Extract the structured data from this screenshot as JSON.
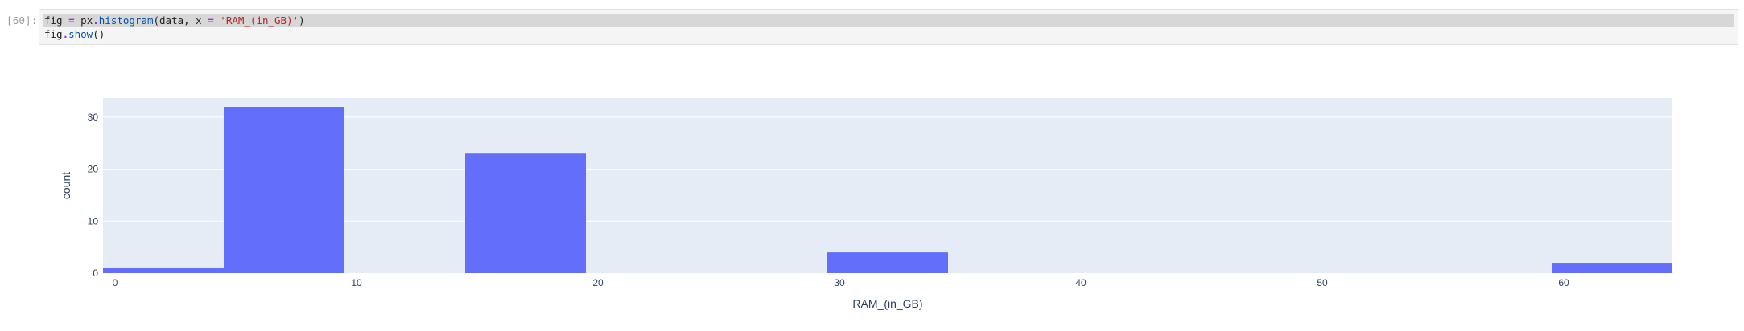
{
  "notebook": {
    "prompt": "[60]:",
    "code": {
      "line1": {
        "fig": "fig",
        "eq": "=",
        "px": "px",
        "dot": ".",
        "fn": "histogram",
        "args_open": "(data, x ",
        "eq2": "=",
        "str": "'RAM_(in_GB)'",
        "close": ")"
      },
      "line2": {
        "fig": "fig",
        "dot": ".",
        "fn": "show",
        "paren": "()"
      }
    }
  },
  "chart_data": {
    "type": "bar",
    "subtype": "histogram",
    "bar_color": "#636efa",
    "plot_bg": "#e5ecf6",
    "bins": [
      {
        "start": -0.5,
        "end": 4.5,
        "count": 1
      },
      {
        "start": 4.5,
        "end": 9.5,
        "count": 32
      },
      {
        "start": 14.5,
        "end": 19.5,
        "count": 23
      },
      {
        "start": 29.5,
        "end": 34.5,
        "count": 4
      },
      {
        "start": 59.5,
        "end": 64.5,
        "count": 2
      }
    ],
    "xlabel": "RAM_(in_GB)",
    "ylabel": "count",
    "xlim": [
      -0.5,
      64.5
    ],
    "ylim": [
      0,
      33.7
    ],
    "x_ticks": [
      "0",
      "10",
      "20",
      "30",
      "40",
      "50",
      "60"
    ],
    "x_tick_values": [
      0,
      10,
      20,
      30,
      40,
      50,
      60
    ],
    "y_ticks": [
      "0",
      "10",
      "20",
      "30"
    ],
    "y_tick_values": [
      0,
      10,
      20,
      30
    ],
    "grid": true
  }
}
